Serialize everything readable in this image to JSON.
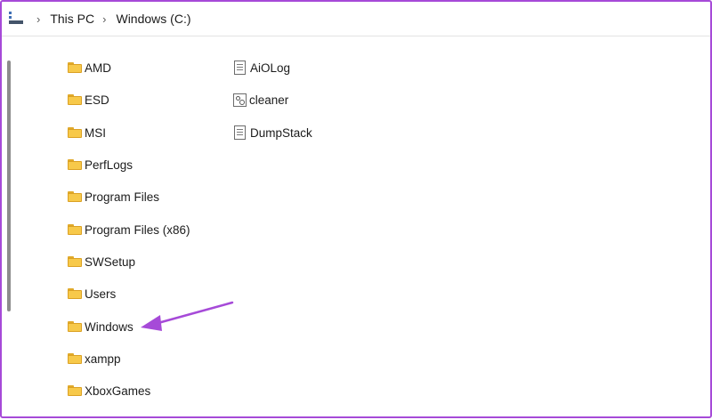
{
  "breadcrumb": {
    "items": [
      "This PC",
      "Windows (C:)"
    ],
    "separator": "›"
  },
  "folders": [
    "AMD",
    "ESD",
    "MSI",
    "PerfLogs",
    "Program Files",
    "Program Files (x86)",
    "SWSetup",
    "Users",
    "Windows",
    "xampp",
    "XboxGames"
  ],
  "files": [
    {
      "name": "AiOLog",
      "icon": "text-file-icon"
    },
    {
      "name": "cleaner",
      "icon": "config-file-icon"
    },
    {
      "name": "DumpStack",
      "icon": "text-file-icon"
    }
  ],
  "colors": {
    "frame_border": "#a64ad8",
    "annotation_arrow": "#a64ad8",
    "folder_fill": "#f7c94a"
  },
  "annotation": {
    "type": "arrow",
    "points_to": "Windows"
  }
}
